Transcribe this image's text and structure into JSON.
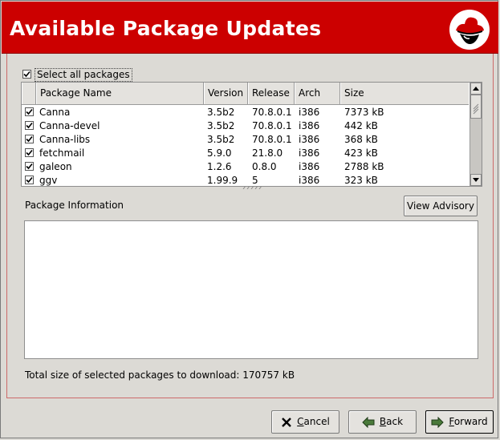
{
  "banner": {
    "title": "Available Package Updates"
  },
  "select_all": {
    "label": "Select all packages",
    "checked": true
  },
  "table": {
    "columns": [
      "Package Name",
      "Version",
      "Release",
      "Arch",
      "Size"
    ],
    "rows": [
      {
        "checked": true,
        "name": "Canna",
        "version": "3.5b2",
        "release": "70.8.0.1",
        "arch": "i386",
        "size": "7373 kB"
      },
      {
        "checked": true,
        "name": "Canna-devel",
        "version": "3.5b2",
        "release": "70.8.0.1",
        "arch": "i386",
        "size": "442 kB"
      },
      {
        "checked": true,
        "name": "Canna-libs",
        "version": "3.5b2",
        "release": "70.8.0.1",
        "arch": "i386",
        "size": "368 kB"
      },
      {
        "checked": true,
        "name": "fetchmail",
        "version": "5.9.0",
        "release": "21.8.0",
        "arch": "i386",
        "size": "423 kB"
      },
      {
        "checked": true,
        "name": "galeon",
        "version": "1.2.6",
        "release": "0.8.0",
        "arch": "i386",
        "size": "2788 kB"
      },
      {
        "checked": true,
        "name": "ggv",
        "version": "1.99.9",
        "release": "5",
        "arch": "i386",
        "size": "323 kB"
      }
    ]
  },
  "package_info": {
    "label": "Package Information",
    "view_advisory": "View Advisory",
    "text": ""
  },
  "total_text": "Total size of selected packages to download: 170757 kB",
  "buttons": {
    "cancel": {
      "label": "Cancel",
      "mnemonic": "C",
      "rest": "ancel"
    },
    "back": {
      "label": "Back",
      "mnemonic": "B",
      "rest": "ack"
    },
    "forward": {
      "label": "Forward",
      "mnemonic": "F",
      "rest": "orward"
    }
  },
  "colors": {
    "banner": "#cc0000",
    "window": "#dcdad5"
  },
  "icons": [
    "redhat-logo-icon",
    "checkbox-icon",
    "scroll-up-icon",
    "scroll-down-icon",
    "cancel-x-icon",
    "back-arrow-icon",
    "forward-arrow-icon"
  ]
}
